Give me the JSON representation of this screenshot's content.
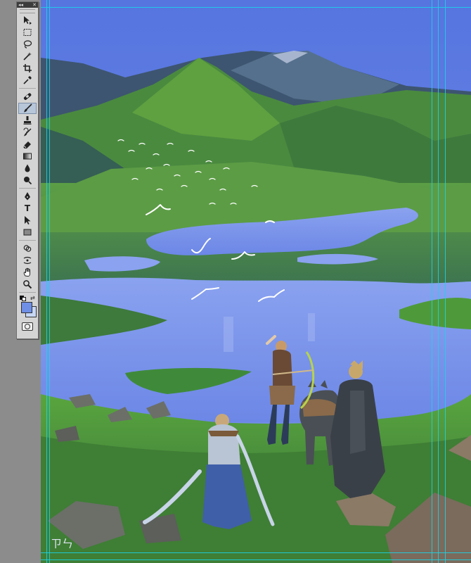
{
  "toolbox": {
    "collapse_glyph": "◂◂",
    "close_glyph": "✕",
    "tools": [
      {
        "name": "move-tool",
        "icon": "move-icon"
      },
      {
        "name": "marquee-tool",
        "icon": "marquee-icon"
      },
      {
        "name": "lasso-tool",
        "icon": "lasso-icon"
      },
      {
        "name": "magic-wand-tool",
        "icon": "magic-wand-icon"
      },
      {
        "name": "crop-tool",
        "icon": "crop-icon"
      },
      {
        "name": "eyedropper-tool",
        "icon": "eyedropper-icon"
      },
      {
        "name": "healing-brush-tool",
        "icon": "bandage-icon"
      },
      {
        "name": "brush-tool",
        "icon": "brush-icon",
        "active": true
      },
      {
        "name": "clone-stamp-tool",
        "icon": "stamp-icon"
      },
      {
        "name": "history-brush-tool",
        "icon": "history-brush-icon"
      },
      {
        "name": "eraser-tool",
        "icon": "eraser-icon"
      },
      {
        "name": "gradient-tool",
        "icon": "gradient-icon"
      },
      {
        "name": "blur-tool",
        "icon": "blur-drop-icon"
      },
      {
        "name": "dodge-tool",
        "icon": "dodge-icon"
      },
      {
        "name": "pen-tool",
        "icon": "pen-icon"
      },
      {
        "name": "type-tool",
        "icon": "type-icon",
        "label": "T"
      },
      {
        "name": "path-selection-tool",
        "icon": "arrow-cursor-icon"
      },
      {
        "name": "shape-tool",
        "icon": "rectangle-icon"
      },
      {
        "name": "3d-rotate-tool",
        "icon": "3d-rotate-icon"
      },
      {
        "name": "3d-orbit-tool",
        "icon": "3d-orbit-icon"
      },
      {
        "name": "hand-tool",
        "icon": "hand-icon"
      },
      {
        "name": "zoom-tool",
        "icon": "magnifier-icon"
      }
    ],
    "foreground_color": "#6f8fe6",
    "background_color": "#c7d6f4"
  },
  "colors": {
    "guide": "#19d6ea",
    "sky": "#5f7fe0",
    "lake": "#7b96ec",
    "grass": "#4f9a3a",
    "mountain": "#3f5b69"
  },
  "artwork": {
    "signature": "ㄗㄣ"
  }
}
